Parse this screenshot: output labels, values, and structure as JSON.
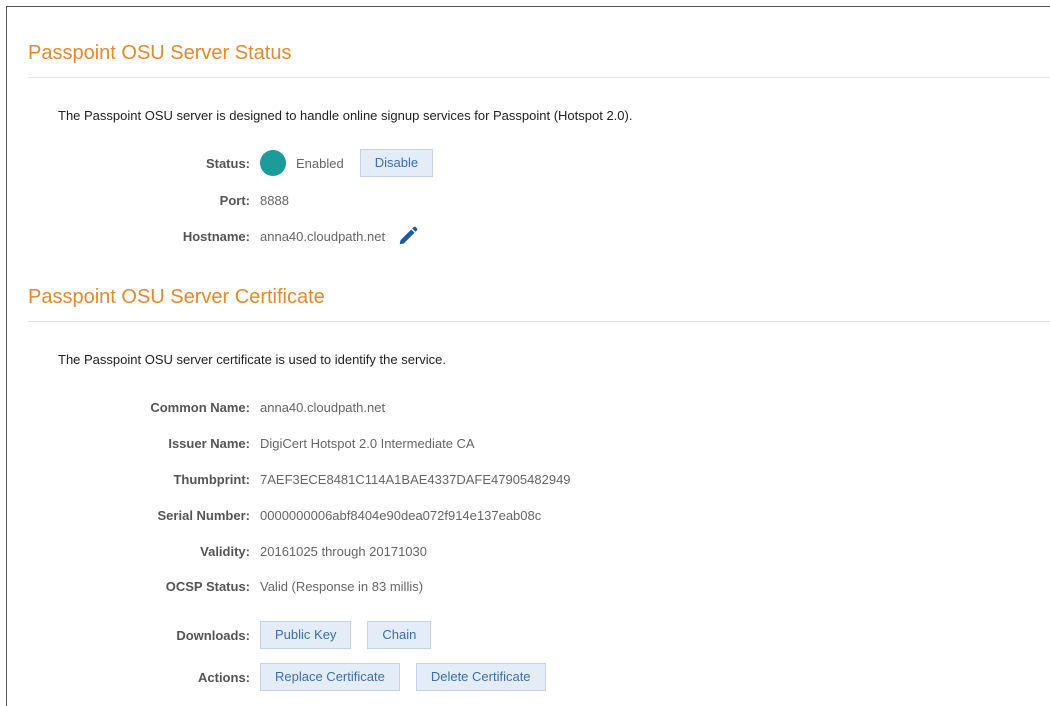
{
  "status_section": {
    "title": "Passpoint OSU Server Status",
    "description": "The Passpoint OSU server is designed to handle online signup services for Passpoint (Hotspot 2.0).",
    "status_label": "Status:",
    "status_value": "Enabled",
    "disable_button": "Disable",
    "port_label": "Port:",
    "port_value": "8888",
    "hostname_label": "Hostname:",
    "hostname_value": "anna40.cloudpath.net",
    "status_color": "#1b9b9a",
    "edit_icon": "pencil-icon"
  },
  "certificate_section": {
    "title": "Passpoint OSU Server Certificate",
    "description": "The Passpoint OSU server certificate is used to identify the service.",
    "fields": [
      {
        "label": "Common Name:",
        "value": "anna40.cloudpath.net"
      },
      {
        "label": "Issuer Name:",
        "value": "DigiCert Hotspot 2.0 Intermediate CA"
      },
      {
        "label": "Thumbprint:",
        "value": "7AEF3ECE8481C114A1BAE4337DAFE47905482949"
      },
      {
        "label": "Serial Number:",
        "value": "0000000006abf8404e90dea072f914e137eab08c"
      },
      {
        "label": "Validity:",
        "value": "20161025 through 20171030"
      },
      {
        "label": "OCSP Status:",
        "value": "Valid (Response in 83 millis)"
      }
    ],
    "downloads_label": "Downloads:",
    "public_key_button": "Public Key",
    "chain_button": "Chain",
    "actions_label": "Actions:",
    "replace_button": "Replace Certificate",
    "delete_button": "Delete Certificate"
  },
  "colors": {
    "title": "#e5892a",
    "button_bg": "#e3ecf7",
    "button_text": "#3b6fb0"
  }
}
